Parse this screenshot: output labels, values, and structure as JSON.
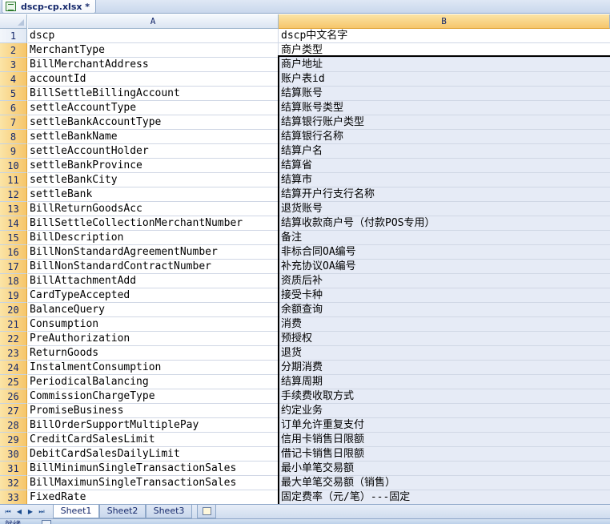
{
  "window": {
    "file_tab_title": "dscp-cp.xlsx *"
  },
  "columns": {
    "a": "A",
    "b": "B"
  },
  "rows": [
    {
      "n": "1",
      "a": "dscp",
      "b": "dscp中文名字"
    },
    {
      "n": "2",
      "a": "MerchantType",
      "b": "商户类型"
    },
    {
      "n": "3",
      "a": "BillMerchantAddress",
      "b": "商户地址"
    },
    {
      "n": "4",
      "a": "accountId",
      "b": "账户表id"
    },
    {
      "n": "5",
      "a": "BillSettleBillingAccount",
      "b": "结算账号"
    },
    {
      "n": "6",
      "a": "settleAccountType",
      "b": "结算账号类型"
    },
    {
      "n": "7",
      "a": "settleBankAccountType",
      "b": "结算银行账户类型"
    },
    {
      "n": "8",
      "a": "settleBankName",
      "b": "结算银行名称"
    },
    {
      "n": "9",
      "a": "settleAccountHolder",
      "b": "结算户名"
    },
    {
      "n": "10",
      "a": "settleBankProvince",
      "b": "结算省"
    },
    {
      "n": "11",
      "a": "settleBankCity",
      "b": "结算市"
    },
    {
      "n": "12",
      "a": "settleBank",
      "b": "结算开户行支行名称"
    },
    {
      "n": "13",
      "a": "BillReturnGoodsAcc",
      "b": "退货账号"
    },
    {
      "n": "14",
      "a": "BillSettleCollectionMerchantNumber",
      "b": "结算收款商户号（付款POS专用）"
    },
    {
      "n": "15",
      "a": "BillDescription",
      "b": "备注"
    },
    {
      "n": "16",
      "a": "BillNonStandardAgreementNumber",
      "b": "非标合同OA编号"
    },
    {
      "n": "17",
      "a": "BillNonStandardContractNumber",
      "b": "补充协议OA编号"
    },
    {
      "n": "18",
      "a": "BillAttachmentAdd",
      "b": "资质后补"
    },
    {
      "n": "19",
      "a": "CardTypeAccepted",
      "b": "接受卡种"
    },
    {
      "n": "20",
      "a": "BalanceQuery",
      "b": "余额查询"
    },
    {
      "n": "21",
      "a": "Consumption",
      "b": "消费"
    },
    {
      "n": "22",
      "a": "PreAuthorization",
      "b": "预授权"
    },
    {
      "n": "23",
      "a": "ReturnGoods",
      "b": "退货"
    },
    {
      "n": "24",
      "a": "InstalmentConsumption",
      "b": "分期消费"
    },
    {
      "n": "25",
      "a": "PeriodicalBalancing",
      "b": "结算周期"
    },
    {
      "n": "26",
      "a": "CommissionChargeType",
      "b": "手续费收取方式"
    },
    {
      "n": "27",
      "a": "PromiseBusiness",
      "b": "约定业务"
    },
    {
      "n": "28",
      "a": "BillOrderSupportMultiplePay",
      "b": "订单允许重复支付"
    },
    {
      "n": "29",
      "a": "CreditCardSalesLimit",
      "b": "信用卡销售日限额"
    },
    {
      "n": "30",
      "a": "DebitCardSalesDailyLimit",
      "b": "借记卡销售日限额"
    },
    {
      "n": "31",
      "a": "BillMinimunSingleTransactionSales",
      "b": "最小单笔交易额"
    },
    {
      "n": "32",
      "a": "BillMaximunSingleTransactionSales",
      "b": "最大单笔交易额（销售）"
    },
    {
      "n": "33",
      "a": "FixedRate",
      "b": "固定费率（元/笔）---固定"
    }
  ],
  "sheets": [
    "Sheet1",
    "Sheet2",
    "Sheet3"
  ],
  "active_sheet": "Sheet1",
  "status": {
    "text": "就绪"
  },
  "nav_icons": [
    "first-sheet-icon",
    "prev-sheet-icon",
    "next-sheet-icon",
    "last-sheet-icon"
  ],
  "colors": {
    "header_bg": "#dbe5f2",
    "selected_header": "#f6c66b",
    "selection_fill": "#e6ebf6",
    "grid_line": "#d0d7e5",
    "header_text": "#15286b"
  }
}
